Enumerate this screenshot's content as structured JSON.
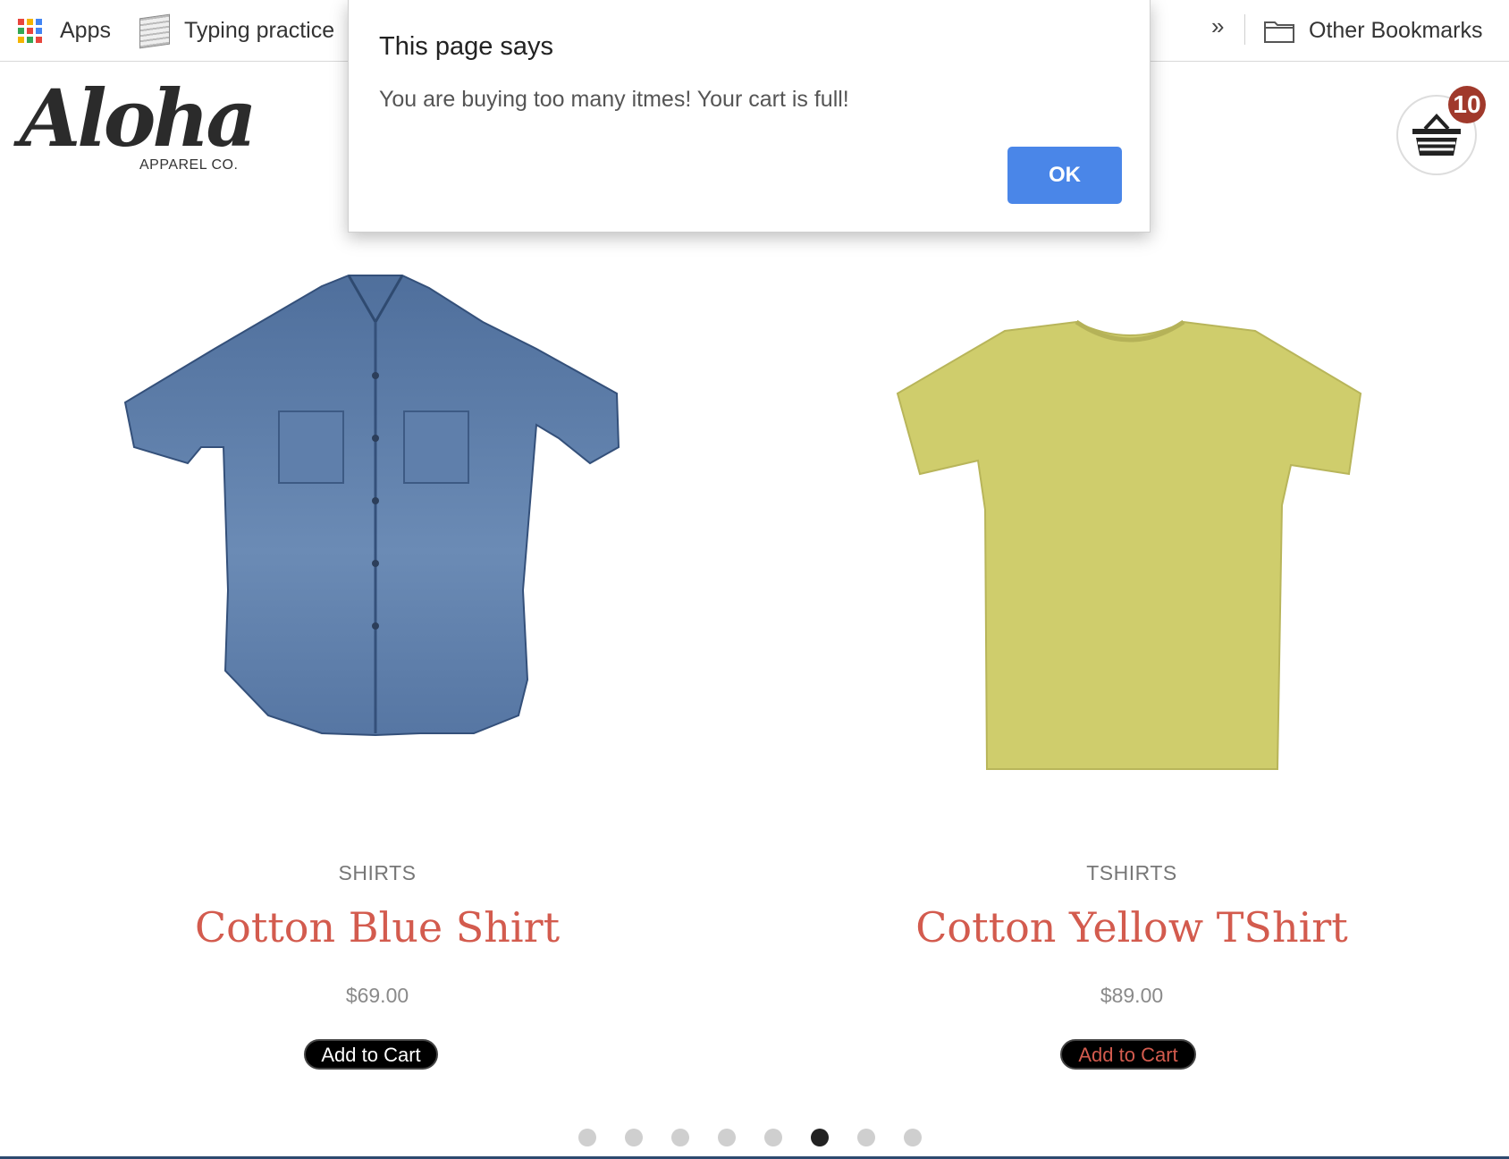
{
  "bookmarks": {
    "apps_label": "Apps",
    "typing_label": "Typing practice",
    "overflow_label": "»",
    "other_label": "Other Bookmarks"
  },
  "header": {
    "logo_script": "Aloha",
    "logo_sub": "APPAREL CO.",
    "cart_count": "10"
  },
  "products": [
    {
      "category": "SHIRTS",
      "title": "Cotton Blue Shirt",
      "price": "$69.00",
      "button": "Add to Cart"
    },
    {
      "category": "TSHIRTS",
      "title": "Cotton Yellow TShirt",
      "price": "$89.00",
      "button": "Add to Cart"
    }
  ],
  "carousel": {
    "total": 8,
    "active_index": 5
  },
  "dialog": {
    "title": "This page says",
    "message": "You are buying too many itmes! Your cart is full!",
    "ok_label": "OK"
  },
  "colors": {
    "accent_red": "#d35b4e",
    "ok_blue": "#4a86e8",
    "badge": "#a0392b"
  }
}
